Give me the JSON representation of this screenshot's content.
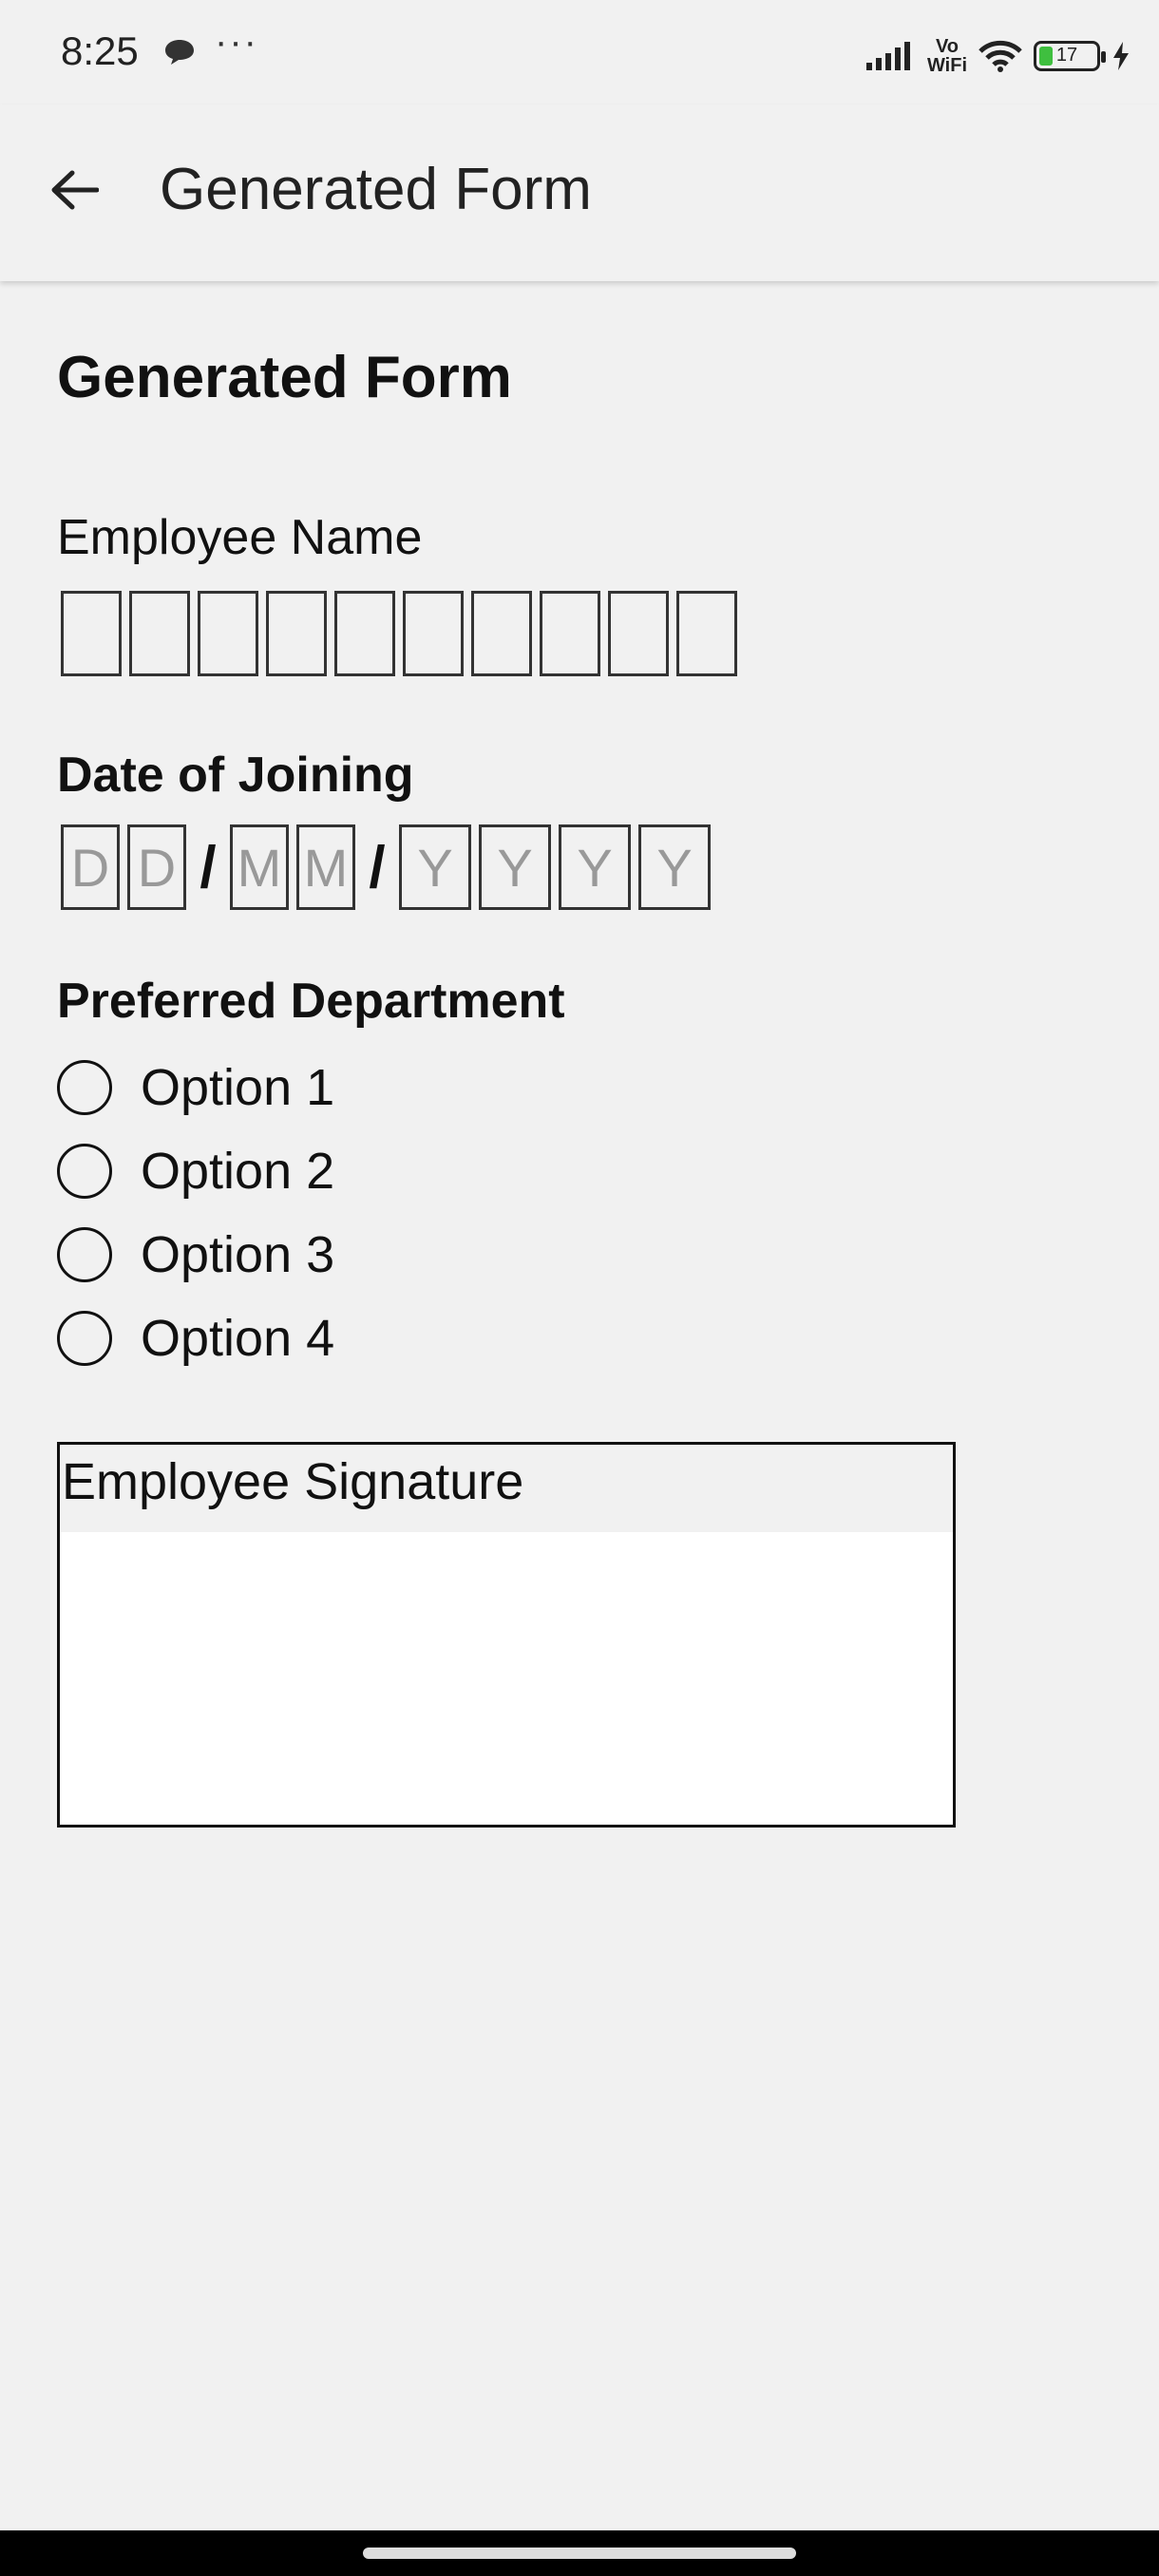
{
  "status_bar": {
    "time": "8:25",
    "dots": "···",
    "network_label": "Vo\nWiFi",
    "battery_level": "17",
    "icons": [
      "chat-icon",
      "signal-icon",
      "vowifi-icon",
      "wifi-icon",
      "battery-icon",
      "charging-bolt-icon"
    ]
  },
  "app_bar": {
    "title": "Generated Form",
    "back_icon": "arrow-left-icon"
  },
  "form": {
    "title": "Generated Form",
    "employee_name": {
      "label": "Employee Name",
      "box_count": 10
    },
    "date_of_joining": {
      "label": "Date of Joining",
      "day": [
        "D",
        "D"
      ],
      "month": [
        "M",
        "M"
      ],
      "year": [
        "Y",
        "Y",
        "Y",
        "Y"
      ],
      "separator": "/"
    },
    "preferred_department": {
      "label": "Preferred Department",
      "options": [
        "Option 1",
        "Option 2",
        "Option 3",
        "Option 4"
      ]
    },
    "signature": {
      "label": "Employee Signature"
    }
  },
  "colors": {
    "background": "#f1f1f1",
    "text": "#111111",
    "placeholder": "#999999",
    "battery": "#3fbf3f"
  }
}
